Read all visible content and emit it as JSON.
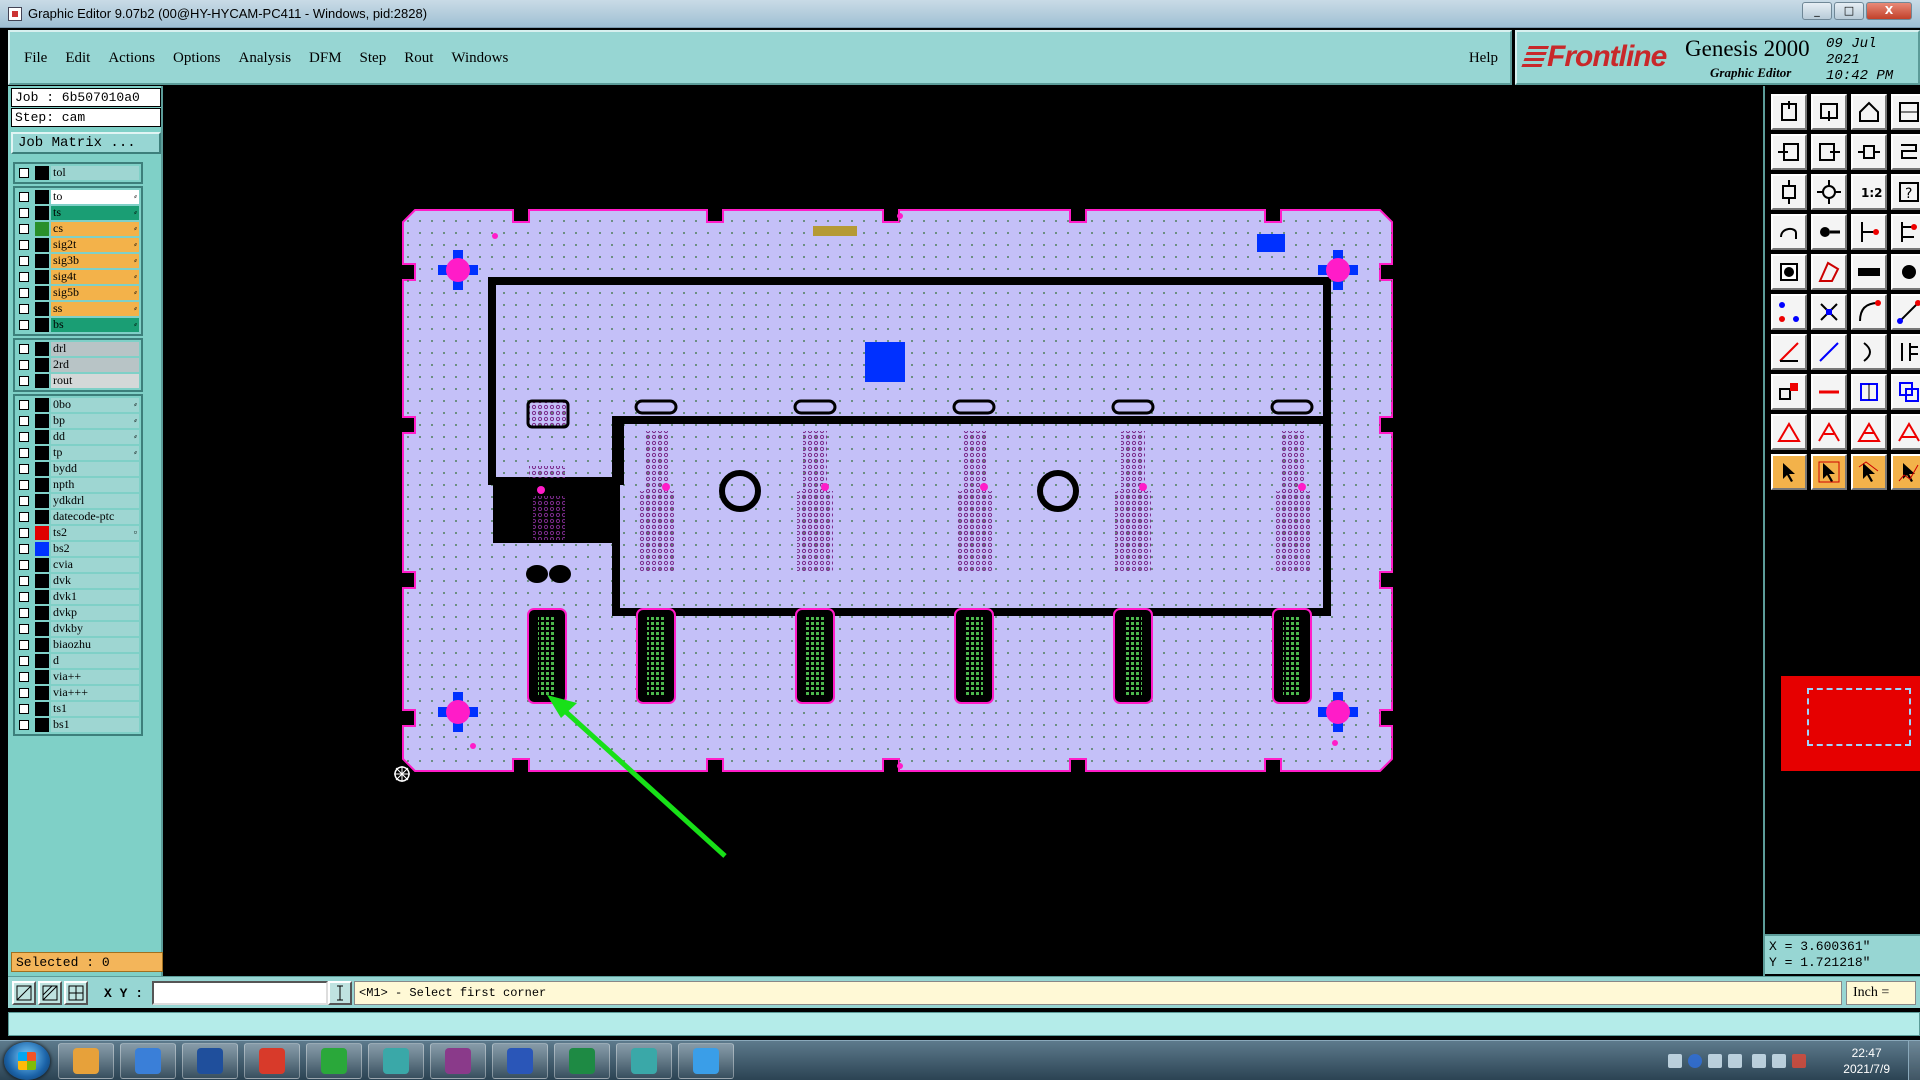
{
  "window": {
    "title": "Graphic Editor 9.07b2 (00@HY-HYCAM-PC411 - Windows, pid:2828)",
    "controls": [
      "_",
      "□",
      "X"
    ]
  },
  "menu": {
    "items": [
      "File",
      "Edit",
      "Actions",
      "Options",
      "Analysis",
      "DFM",
      "Step",
      "Rout",
      "Windows"
    ],
    "help": "Help"
  },
  "brand": {
    "logo": "Frontline",
    "product": "Genesis 2000",
    "subtitle": "Graphic Editor",
    "date": "09 Jul 2021",
    "time": "10:42 PM"
  },
  "left_panel": {
    "job": "Job : 6b507010a0",
    "step": "Step: cam",
    "job_matrix": "Job Matrix ...",
    "groups": [
      [
        {
          "name": "tol",
          "swatch": "#000000",
          "bg": "#9ed6d2",
          "mark": ""
        }
      ],
      [
        {
          "name": "to",
          "swatch": "#000000",
          "bg": "#ffffff",
          "mark": "⸗"
        },
        {
          "name": "ts",
          "swatch": "#000000",
          "bg": "#1a9e74",
          "mark": "⸗"
        },
        {
          "name": "cs",
          "swatch": "#2a8f2a",
          "bg": "#f3b24a",
          "mark": "⸗"
        },
        {
          "name": "sig2t",
          "swatch": "#000000",
          "bg": "#f3b24a",
          "mark": "⸗"
        },
        {
          "name": "sig3b",
          "swatch": "#000000",
          "bg": "#f3b24a",
          "mark": "⸗"
        },
        {
          "name": "sig4t",
          "swatch": "#000000",
          "bg": "#f3b24a",
          "mark": "⸗"
        },
        {
          "name": "sig5b",
          "swatch": "#000000",
          "bg": "#f3b24a",
          "mark": "⸗"
        },
        {
          "name": "ss",
          "swatch": "#000000",
          "bg": "#f3b24a",
          "mark": "⸗"
        },
        {
          "name": "bs",
          "swatch": "#000000",
          "bg": "#1a9e74",
          "mark": "⸗"
        }
      ],
      [
        {
          "name": "drl",
          "swatch": "#000000",
          "bg": "#b8c4c6",
          "mark": ""
        },
        {
          "name": "2rd",
          "swatch": "#000000",
          "bg": "#b8c4c6",
          "mark": ""
        },
        {
          "name": "rout",
          "swatch": "#000000",
          "bg": "#d4d8d8",
          "mark": ""
        }
      ],
      [
        {
          "name": "0bo",
          "swatch": "#000000",
          "bg": "#9ed6d2",
          "mark": "⸗"
        },
        {
          "name": "bp",
          "swatch": "#000000",
          "bg": "#9ed6d2",
          "mark": "⸗"
        },
        {
          "name": "dd",
          "swatch": "#000000",
          "bg": "#9ed6d2",
          "mark": "⸗"
        },
        {
          "name": "tp",
          "swatch": "#000000",
          "bg": "#9ed6d2",
          "mark": "⸗"
        },
        {
          "name": "bydd",
          "swatch": "#000000",
          "bg": "#9ed6d2",
          "mark": ""
        },
        {
          "name": "npth",
          "swatch": "#000000",
          "bg": "#9ed6d2",
          "mark": ""
        },
        {
          "name": "ydkdrl",
          "swatch": "#000000",
          "bg": "#9ed6d2",
          "mark": ""
        },
        {
          "name": "datecode-ptc",
          "swatch": "#000000",
          "bg": "#9ed6d2",
          "mark": ""
        },
        {
          "name": "ts2",
          "swatch": "#e00000",
          "bg": "#9ed6d2",
          "mark": "▫"
        },
        {
          "name": "bs2",
          "swatch": "#0033ff",
          "bg": "#9ed6d2",
          "mark": ""
        },
        {
          "name": "cvia",
          "swatch": "#000000",
          "bg": "#9ed6d2",
          "mark": ""
        },
        {
          "name": "dvk",
          "swatch": "#000000",
          "bg": "#9ed6d2",
          "mark": ""
        },
        {
          "name": "dvk1",
          "swatch": "#000000",
          "bg": "#9ed6d2",
          "mark": ""
        },
        {
          "name": "dvkp",
          "swatch": "#000000",
          "bg": "#9ed6d2",
          "mark": ""
        },
        {
          "name": "dvkby",
          "swatch": "#000000",
          "bg": "#9ed6d2",
          "mark": ""
        },
        {
          "name": "biaozhu",
          "swatch": "#000000",
          "bg": "#9ed6d2",
          "mark": ""
        },
        {
          "name": "d",
          "swatch": "#000000",
          "bg": "#9ed6d2",
          "mark": ""
        },
        {
          "name": "via++",
          "swatch": "#000000",
          "bg": "#9ed6d2",
          "mark": ""
        },
        {
          "name": "via+++",
          "swatch": "#000000",
          "bg": "#9ed6d2",
          "mark": ""
        },
        {
          "name": "ts1",
          "swatch": "#000000",
          "bg": "#9ed6d2",
          "mark": ""
        },
        {
          "name": "bs1",
          "swatch": "#000000",
          "bg": "#9ed6d2",
          "mark": ""
        }
      ]
    ],
    "selected": "Selected : 0"
  },
  "canvas": {
    "board_color": "#c4c0f8",
    "pad_color": "#ff1cc8",
    "target_color": "#0030ff",
    "arrow_color": "#18e018"
  },
  "tools": [
    {
      "icon": "zoom-home-icon",
      "style": "white"
    },
    {
      "icon": "zoom-out-icon",
      "style": "white"
    },
    {
      "icon": "home-icon",
      "style": "white"
    },
    {
      "icon": "layout-icon",
      "style": "white"
    },
    {
      "icon": "pan-left-icon",
      "style": "white"
    },
    {
      "icon": "pan-right-icon",
      "style": "white"
    },
    {
      "icon": "pan-bidir-icon",
      "style": "white"
    },
    {
      "icon": "snake-icon",
      "style": "white"
    },
    {
      "icon": "fit-vertical-icon",
      "style": "white"
    },
    {
      "icon": "fit-all-icon",
      "style": "white"
    },
    {
      "icon": "one-to-one-icon",
      "style": "white"
    },
    {
      "icon": "help-icon",
      "style": "white"
    },
    {
      "icon": "hand-icon",
      "style": "white"
    },
    {
      "icon": "measure-icon",
      "style": "white"
    },
    {
      "icon": "route-icon",
      "style": "white"
    },
    {
      "icon": "route-alt-icon",
      "style": "white"
    },
    {
      "icon": "pad-icon",
      "style": "white"
    },
    {
      "icon": "polygon-icon",
      "style": "white"
    },
    {
      "icon": "keyboard-icon",
      "style": "white"
    },
    {
      "icon": "circle-icon",
      "style": "white"
    },
    {
      "icon": "node-icon",
      "style": "white"
    },
    {
      "icon": "cross-icon",
      "style": "white"
    },
    {
      "icon": "arc-icon",
      "style": "white"
    },
    {
      "icon": "line-icon",
      "style": "white"
    },
    {
      "icon": "draw-line-icon",
      "style": "white"
    },
    {
      "icon": "slash-icon",
      "style": "white"
    },
    {
      "icon": "curve-icon",
      "style": "white"
    },
    {
      "icon": "split-icon",
      "style": "white"
    },
    {
      "icon": "add-pad-icon",
      "style": "white"
    },
    {
      "icon": "minus-icon",
      "style": "white"
    },
    {
      "icon": "move-icon",
      "style": "white"
    },
    {
      "icon": "copy-icon",
      "style": "white"
    },
    {
      "icon": "triangle-icon",
      "style": "white"
    },
    {
      "icon": "triangle-a-icon",
      "style": "white"
    },
    {
      "icon": "triangle-b-icon",
      "style": "white"
    },
    {
      "icon": "triangle-c-icon",
      "style": "white"
    },
    {
      "icon": "select-icon",
      "style": "orange"
    },
    {
      "icon": "select-box-icon",
      "style": "orange"
    },
    {
      "icon": "select-poly-icon",
      "style": "orange"
    },
    {
      "icon": "select-chain-icon",
      "style": "orange"
    }
  ],
  "coords": {
    "x": "X = 3.600361\"",
    "y": "Y = 1.721218\""
  },
  "status": {
    "xy_label": "X Y :",
    "xy_value": "",
    "prompt": "<M1> - Select first corner",
    "units": "Inch ="
  },
  "taskbar": {
    "time": "22:47",
    "date": "2021/7/9",
    "apps": [
      "folder-icon",
      "notepad-icon",
      "save-icon",
      "refresh-app-icon",
      "pads-app-icon",
      "fish-app-icon",
      "x-app-icon",
      "word-icon",
      "excel-icon",
      "fish-app-2-icon",
      "telegram-icon"
    ]
  }
}
